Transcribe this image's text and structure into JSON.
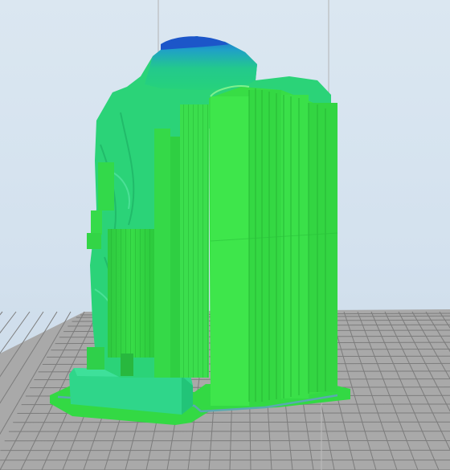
{
  "viewport": {
    "view_mode": "layer-preview",
    "model_name": "",
    "colors": {
      "background_top": "#dbe7f1",
      "background_bottom": "#c9d8e6",
      "bed_fill": "#a9a9a9",
      "bed_grid": "#7a7a7a",
      "support_green": "#33d946",
      "model_green": "#22d47a",
      "top_blue": "#1f5fd0",
      "axis_line": "#b8b8b8"
    },
    "icons": [
      "build-plate-grid",
      "support-structure",
      "printed-model",
      "vertical-guide-line"
    ]
  }
}
